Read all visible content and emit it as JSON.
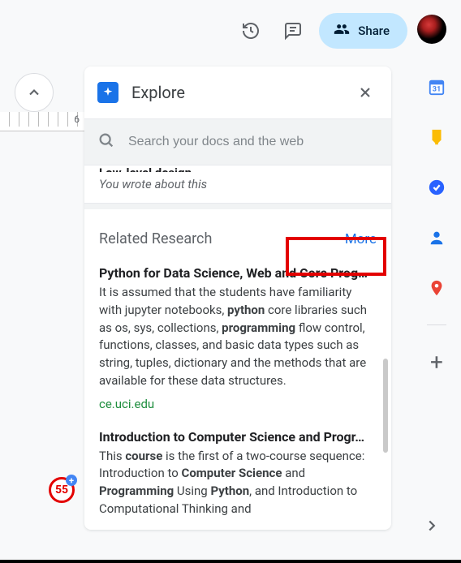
{
  "toolbar": {
    "share_label": "Share"
  },
  "explore": {
    "title": "Explore",
    "search_placeholder": "Search your docs and the web",
    "previous_topic": {
      "title": "Low-level design",
      "subtitle": "You wrote about this"
    },
    "related": {
      "section_label": "Related Research",
      "more_label": "More",
      "results": [
        {
          "title": "Python for Data Science, Web and Core Prog…",
          "snippet_parts": [
            "It is assumed that the students have familiarity with jupyter notebooks, ",
            "python",
            " core libraries such as os, sys, collections, ",
            "programming",
            " flow control, functions, classes, and basic data types such as string, tuples, dictionary and the methods that are available for these data structures."
          ],
          "bold_idx": [
            1,
            3
          ],
          "url": "ce.uci.edu"
        },
        {
          "title": "Introduction to Computer Science and Progr…",
          "snippet_parts": [
            "This ",
            "course",
            " is the first of a two-course sequence: Introduction to ",
            "Computer Science",
            " and ",
            "Programming",
            " Using ",
            "Python",
            ", and Introduction to Computational Thinking and"
          ],
          "bold_idx": [
            1,
            3,
            5,
            7
          ],
          "url": ""
        }
      ]
    }
  },
  "side": {
    "items": [
      "calendar",
      "keep",
      "tasks",
      "contacts",
      "maps"
    ]
  },
  "badge": {
    "count": "55"
  },
  "ruler": {
    "mark": "6"
  }
}
